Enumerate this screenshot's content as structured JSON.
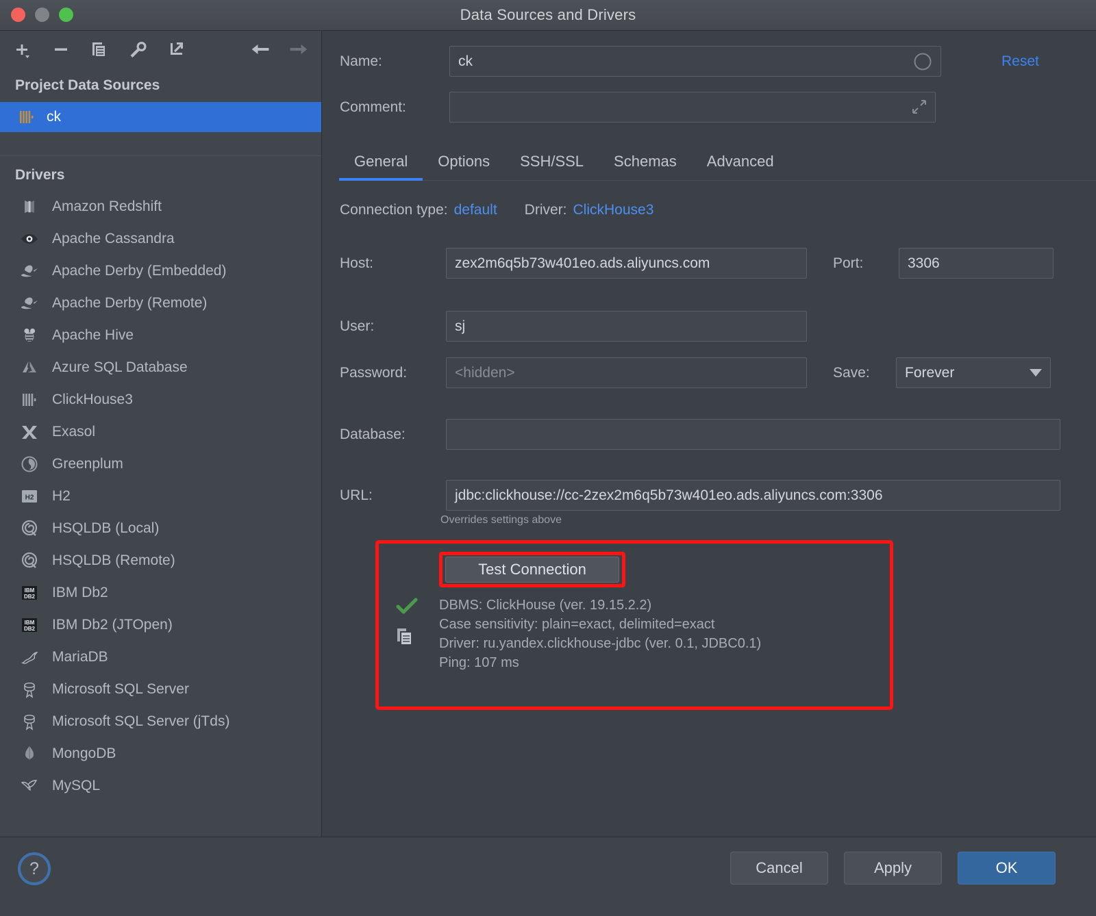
{
  "window": {
    "title": "Data Sources and Drivers",
    "traffic_lights": [
      "close",
      "minimize",
      "zoom"
    ]
  },
  "sidebar": {
    "toolbar_icons": [
      "add-icon",
      "remove-icon",
      "copy-icon",
      "wrench-icon",
      "import-icon",
      "back-arrow-icon",
      "forward-arrow-icon"
    ],
    "project_header": "Project Data Sources",
    "data_sources": [
      {
        "label": "ck",
        "icon": "clickhouse-icon",
        "selected": true
      }
    ],
    "drivers_header": "Drivers",
    "drivers": [
      {
        "label": "Amazon Redshift",
        "icon": "redshift-icon"
      },
      {
        "label": "Apache Cassandra",
        "icon": "cassandra-eye-icon"
      },
      {
        "label": "Apache Derby (Embedded)",
        "icon": "derby-hat-icon"
      },
      {
        "label": "Apache Derby (Remote)",
        "icon": "derby-hat-icon"
      },
      {
        "label": "Apache Hive",
        "icon": "hive-bee-icon"
      },
      {
        "label": "Azure SQL Database",
        "icon": "azure-icon"
      },
      {
        "label": "ClickHouse3",
        "icon": "clickhouse-icon"
      },
      {
        "label": "Exasol",
        "icon": "exasol-x-icon"
      },
      {
        "label": "Greenplum",
        "icon": "greenplum-icon"
      },
      {
        "label": "H2",
        "icon": "h2-icon"
      },
      {
        "label": "HSQLDB (Local)",
        "icon": "hsqldb-icon"
      },
      {
        "label": "HSQLDB (Remote)",
        "icon": "hsqldb-icon"
      },
      {
        "label": "IBM Db2",
        "icon": "ibm-db2-icon"
      },
      {
        "label": "IBM Db2 (JTOpen)",
        "icon": "ibm-db2-icon"
      },
      {
        "label": "MariaDB",
        "icon": "mariadb-seal-icon"
      },
      {
        "label": "Microsoft SQL Server",
        "icon": "mssql-icon"
      },
      {
        "label": "Microsoft SQL Server (jTds)",
        "icon": "mssql-icon"
      },
      {
        "label": "MongoDB",
        "icon": "mongodb-leaf-icon"
      },
      {
        "label": "MySQL",
        "icon": "mysql-dolphin-icon"
      }
    ]
  },
  "form": {
    "name_label": "Name:",
    "name_value": "ck",
    "comment_label": "Comment:",
    "comment_value": "",
    "reset_label": "Reset",
    "tabs": [
      {
        "label": "General",
        "active": true
      },
      {
        "label": "Options",
        "active": false
      },
      {
        "label": "SSH/SSL",
        "active": false
      },
      {
        "label": "Schemas",
        "active": false
      },
      {
        "label": "Advanced",
        "active": false
      }
    ],
    "connection_type_label": "Connection type:",
    "connection_type_value": "default",
    "driver_label": "Driver:",
    "driver_value": "ClickHouse3",
    "host_label": "Host:",
    "host_value": "zex2m6q5b73w401eo.ads.aliyuncs.com",
    "port_label": "Port:",
    "port_value": "3306",
    "user_label": "User:",
    "user_value": "sj",
    "password_label": "Password:",
    "password_value": "<hidden>",
    "save_label": "Save:",
    "save_value": "Forever",
    "database_label": "Database:",
    "database_value": "",
    "url_label": "URL:",
    "url_value": "jdbc:clickhouse://cc-2zex2m6q5b73w401eo.ads.aliyuncs.com:3306",
    "url_hint": "Overrides settings above"
  },
  "test_connection": {
    "button_label": "Test Connection",
    "status_icon": "green-check-icon",
    "copy_icon": "copy-icon",
    "lines": [
      "DBMS: ClickHouse (ver. 19.15.2.2)",
      "Case sensitivity: plain=exact, delimited=exact",
      "Driver: ru.yandex.clickhouse-jdbc (ver. 0.1, JDBC0.1)",
      "Ping: 107 ms"
    ],
    "highlight_color": "#ff1414"
  },
  "footer": {
    "help_label": "?",
    "cancel_label": "Cancel",
    "apply_label": "Apply",
    "ok_label": "OK"
  },
  "colors": {
    "accent": "#3d82f5",
    "selection": "#2f6fd6",
    "background": "#3c4148",
    "sidebar": "#41464d",
    "success": "#4a9b4a",
    "highlight": "#ff1414"
  }
}
